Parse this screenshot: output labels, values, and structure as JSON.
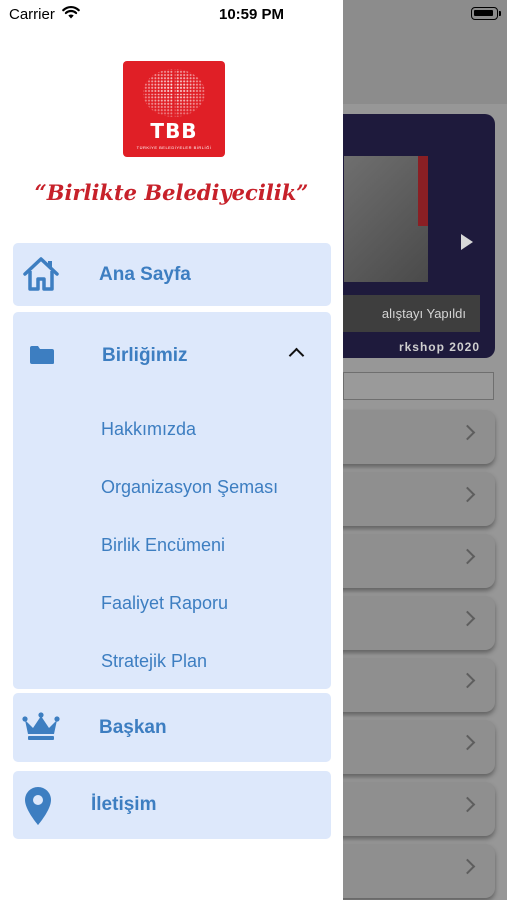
{
  "status_bar": {
    "carrier": "Carrier",
    "time": "10:59 PM"
  },
  "logo": {
    "text": "TBB",
    "subtitle": "TÜRKİYE BELEDİYELER BİRLİĞİ",
    "slogan": "“Birlikte Belediyecilik”"
  },
  "menu": {
    "home_label": "Ana Sayfa",
    "union_label": "Birliğimiz",
    "union_items": [
      "Hakkımızda",
      "Organizasyon Şeması",
      "Birlik Encümeni",
      "Faaliyet Raporu",
      "Stratejik Plan"
    ],
    "president_label": "Başkan",
    "contact_label": "İletişim"
  },
  "background": {
    "banner_caption": "alıştayı Yapıldı",
    "banner_subcaption": "rkshop 2020"
  },
  "colors": {
    "accent": "#3d7ec1",
    "card_bg": "#dde8fb",
    "brand_red": "#e01f26"
  },
  "icons": [
    "home-icon",
    "folder-icon",
    "chevron-up-icon",
    "crown-icon",
    "location-pin-icon",
    "wifi-icon",
    "battery-icon",
    "play-icon",
    "chevron-right-icon"
  ]
}
